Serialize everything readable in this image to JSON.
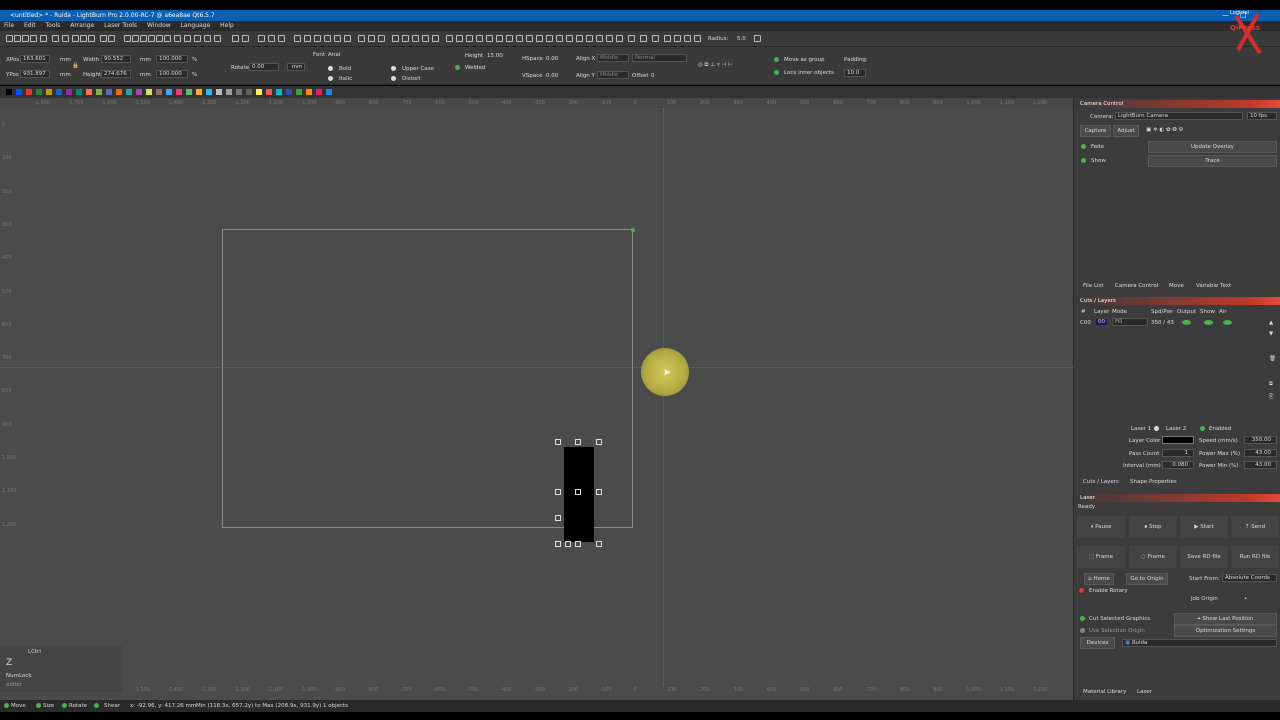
{
  "window": {
    "title": "<untitled> * - Ruida - LightBurn Pro 2.0.00-RC-7 @ a6ea8ae Qt6.5.7"
  },
  "menu": [
    "File",
    "Edit",
    "Tools",
    "Arrange",
    "Laser Tools",
    "Window",
    "Language",
    "Help"
  ],
  "radius": {
    "label": "Radius:",
    "value": "5.0"
  },
  "props": {
    "xpos_label": "XPos",
    "xpos": "163.601",
    "ypos_label": "YPos",
    "ypos": "931.897",
    "unit": "mm",
    "width_label": "Width",
    "width": "90.552",
    "height_label": "Height",
    "height": "274.676",
    "pct1": "100.000",
    "pct2": "100.000",
    "pct": "%",
    "rotate_label": "Rotate",
    "rotate": "0.00",
    "mm_btn": "mm",
    "font_label": "Font",
    "font": "Arial",
    "bold": "Bold",
    "italic": "Italic",
    "upper": "Upper Case",
    "welded": "Welded",
    "distort": "Distort",
    "fheight_label": "Height",
    "fheight": "15.00",
    "hspace_label": "HSpace",
    "hspace": "0.00",
    "vspace_label": "VSpace",
    "vspace": "0.00",
    "alignx_label": "Align X",
    "alignx": "Middle",
    "aligny_label": "Align Y",
    "aligny": "Middle",
    "normal": "Normal",
    "offset_label": "Offset",
    "offset": "0",
    "move_group": "Move as group",
    "lock_inner": "Lock inner objects",
    "padding_label": "Padding:",
    "padding": "10.0"
  },
  "palette_colors": [
    "#000",
    "#0050ff",
    "#e53935",
    "#2e7d32",
    "#c0a000",
    "#1565c0",
    "#9c27b0",
    "#00897b",
    "#ff7043",
    "#7cb342",
    "#5c6bc0",
    "#ef6c00",
    "#26a69a",
    "#ab47bc",
    "#d4e157",
    "#8d6e63",
    "#42a5f5",
    "#ec407a",
    "#66bb6a",
    "#ffa726",
    "#29b6f6",
    "#bdbdbd",
    "#9e9e9e",
    "#757575",
    "#616161",
    "#ffee58",
    "#ff5252",
    "#00bcd4",
    "#3949ab",
    "#43a047",
    "#fb8c00",
    "#e91e63",
    "#1e88e5"
  ],
  "ruler_top": [
    "-1,800",
    "-1,700",
    "-1,600",
    "-1,500",
    "-1,400",
    "-1,300",
    "-1,200",
    "-1,100",
    "-1,000",
    "-900",
    "-800",
    "-700",
    "-600",
    "-500",
    "-400",
    "-300",
    "-200",
    "-100",
    "0",
    "100",
    "200",
    "300",
    "400",
    "500",
    "600",
    "700",
    "800",
    "900",
    "1,000",
    "1,100",
    "1,200"
  ],
  "ruler_left": [
    "0",
    "100",
    "200",
    "300",
    "400",
    "500",
    "600",
    "700",
    "800",
    "900",
    "1,000",
    "1,100",
    "1,200"
  ],
  "keys": {
    "ctrl": "LCtrl",
    "z": "Z",
    "numlock": "NumLock",
    "extra": "éditer"
  },
  "status": {
    "move": "Move",
    "size": "Size",
    "rotate": "Rotate",
    "shear": "Shear",
    "coords": "x: -92.96, y: 417.26 mm",
    "range": "Min (118.3x, 657.2y) to Max (208.9x, 931.9y)  1 objects"
  },
  "camera": {
    "header": "Camera Control",
    "camera_label": "Camera:",
    "camera": "LightBurn Camera",
    "fps": "10 fps",
    "capture": "Capture",
    "adjust": "Adjust",
    "fade": "Fade",
    "show": "Show",
    "update": "Update Overlay",
    "trace": "Trace"
  },
  "tabs1": [
    "File List",
    "Camera Control",
    "Move",
    "Variable Text"
  ],
  "cuts": {
    "header": "Cuts / Layers",
    "cols": [
      "#",
      "Layer",
      "Mode",
      "Spd/Pwr",
      "Output",
      "Show",
      "Air"
    ],
    "row": {
      "num": "C00",
      "layer": "00",
      "mode": "Fill",
      "spd": "350 / 43"
    }
  },
  "layer_settings": {
    "laser1": "Laser 1",
    "laser2": "Laser 2",
    "enabled": "Enabled",
    "color_label": "Layer Color",
    "speed_label": "Speed (mm/s)",
    "speed": "350.00",
    "pass_label": "Pass Count",
    "pass": "1",
    "pmax_label": "Power Max (%)",
    "pmax": "43.00",
    "interval_label": "Interval (mm)",
    "interval": "0.080",
    "pmin_label": "Power Min (%)",
    "pmin": "43.00"
  },
  "tabs2": [
    "Cuts / Layers",
    "Shape Properties"
  ],
  "laser": {
    "header": "Laser",
    "status": "Ready",
    "pause": "Pause",
    "stop": "Stop",
    "start": "Start",
    "send": "Send",
    "frame1": "Frame",
    "frame2": "Frame",
    "save_rd": "Save RD file",
    "run_rd": "Run RD file",
    "home": "Home",
    "goto_origin": "Go to Origin",
    "start_from_label": "Start From:",
    "start_from": "Absolute Coords",
    "rotary": "Enable Rotary",
    "job_origin": "Job Origin",
    "cut_selected": "Cut Selected Graphics",
    "show_last": "Show Last Position",
    "use_selection": "Use Selection Origin",
    "optimization": "Optimization Settings",
    "devices": "Devices",
    "device": "Ruida"
  },
  "tabs3": [
    "Material Library",
    "Laser"
  ],
  "logo": {
    "top": "Logiciel",
    "brand": "QiPress"
  }
}
